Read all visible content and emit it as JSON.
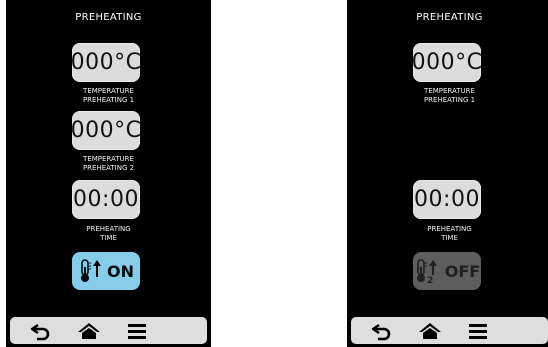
{
  "left": {
    "title": "PREHEATING",
    "temp1": {
      "value": "000°C",
      "caption_line1": "TEMPERATURE",
      "caption_line2": "PREHEATING 1"
    },
    "temp2": {
      "value": "000°C",
      "caption_line1": "TEMPERATURE",
      "caption_line2": "PREHEATING 2"
    },
    "time": {
      "value": "00:00",
      "caption_line1": "PREHEATING",
      "caption_line2": "TIME"
    },
    "toggle": {
      "label": "ON",
      "icon": "thermometer-up-icon",
      "color": "#86cde9"
    }
  },
  "right": {
    "title": "PREHEATING",
    "temp1": {
      "value": "000°C",
      "caption_line1": "TEMPERATURE",
      "caption_line2": "PREHEATING 1"
    },
    "time": {
      "value": "00:00",
      "caption_line1": "PREHEATING",
      "caption_line2": "TIME"
    },
    "toggle": {
      "label": "OFF",
      "icon": "thermometer-2-up-icon",
      "sub_label": "2",
      "color": "#5d5d5d"
    }
  },
  "navbar": {
    "buttons": [
      {
        "icon": "back-arrow-icon"
      },
      {
        "icon": "home-icon"
      },
      {
        "icon": "menu-icon"
      }
    ]
  }
}
